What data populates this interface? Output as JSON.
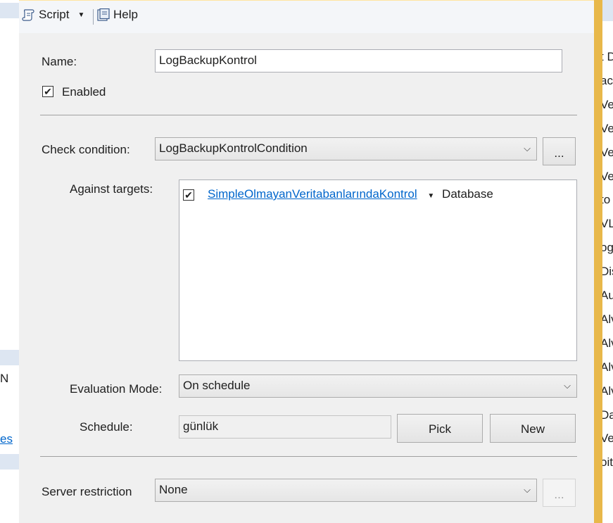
{
  "toolbar": {
    "script_label": "Script",
    "help_label": "Help"
  },
  "form": {
    "name_label": "Name:",
    "name_value": "LogBackupKontrol",
    "enabled_label": "Enabled",
    "enabled_checked": true,
    "check_condition_label": "Check condition:",
    "check_condition_value": "LogBackupKontrolCondition",
    "ellipsis_label": "...",
    "against_targets_label": "Against targets:",
    "target_link": "SimpleOlmayanVeritabanlarındaKontrol",
    "target_suffix": "Database",
    "evaluation_mode_label": "Evaluation Mode:",
    "evaluation_mode_value": "On schedule",
    "schedule_label": "Schedule:",
    "schedule_value": "günlük",
    "pick_label": "Pick",
    "new_label": "New",
    "server_restriction_label": "Server restriction",
    "server_restriction_value": "None",
    "server_ellipsis_label": "..."
  },
  "left_pane": {
    "n_text": "N",
    "es_link": "es"
  },
  "right_pane": {
    "items": [
      "t D",
      "ac",
      "Ve",
      "Ve",
      "Ve",
      "Ve",
      "to",
      "VL",
      "og",
      "Dis",
      "Au",
      "Alv",
      "Alv",
      "Alv",
      "Alv",
      "Da",
      "Ve",
      "oit"
    ]
  }
}
